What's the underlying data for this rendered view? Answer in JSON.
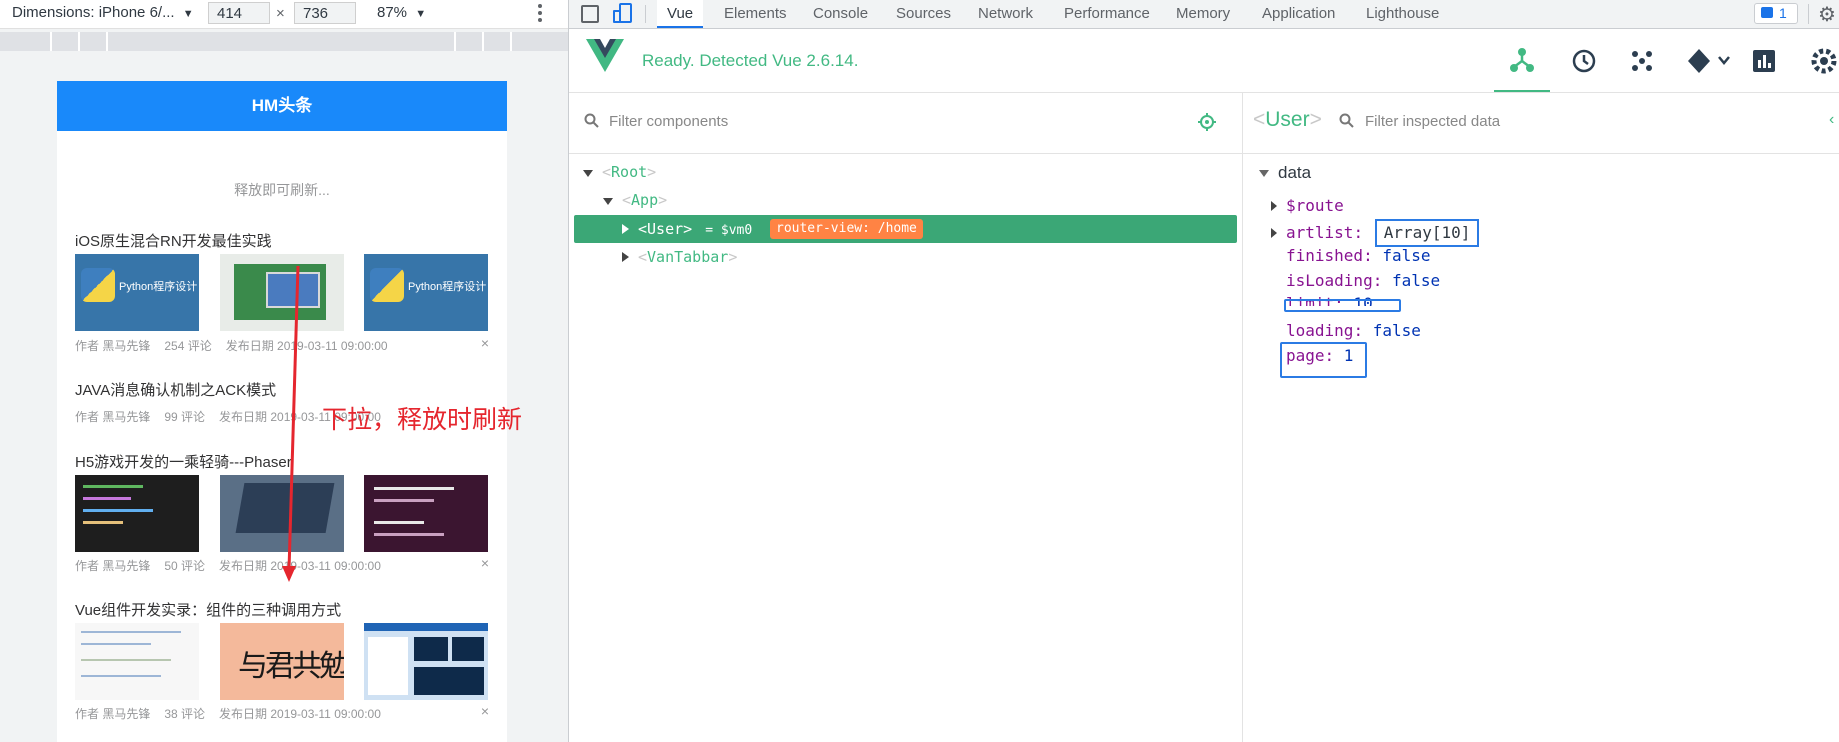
{
  "device_toolbar": {
    "dimensions_label": "Dimensions: iPhone 6/...",
    "width": "414",
    "times": "×",
    "height": "736",
    "zoom": "87%",
    "more_icon": "kebab-menu-icon"
  },
  "phone": {
    "nav_title": "HM头条",
    "pull_text": "释放即可刷新...",
    "articles": [
      {
        "title": "iOS原生混合RN开发最佳实践",
        "author": "作者 黑马先锋",
        "comments": "254 评论",
        "date": "发布日期 2019-03-11 09:00:00",
        "thumbs": [
          "python",
          "circuit",
          "python"
        ],
        "thumb_text": "Python程序设计"
      },
      {
        "title": "JAVA消息确认机制之ACK模式",
        "author": "作者 黑马先锋",
        "comments": "99 评论",
        "date": "发布日期 2019-03-11 09:00:00"
      },
      {
        "title": "H5游戏开发的一乘轻骑---Phaser",
        "author": "作者 黑马先锋",
        "comments": "50 评论",
        "date": "发布日期 2019-03-11 09:00:00"
      },
      {
        "title": "Vue组件开发实录：组件的三种调用方式",
        "author": "作者 黑马先锋",
        "comments": "38 评论",
        "date": "发布日期 2019-03-11 09:00:00",
        "calligraphy": "与君共勉"
      }
    ],
    "close_symbol": "×",
    "annotation": "下拉，释放时刷新"
  },
  "devtools_tabs": [
    "Vue",
    "Elements",
    "Console",
    "Sources",
    "Network",
    "Performance",
    "Memory",
    "Application",
    "Lighthouse"
  ],
  "active_tab": "Vue",
  "message_count": "1",
  "vue": {
    "status": "Ready. Detected Vue 2.6.14.",
    "accent_color": "#42b983",
    "filter_components_placeholder": "Filter components",
    "tree": {
      "root": "Root",
      "app": "App",
      "user": "User",
      "user_suffix": "= $vm0",
      "router_badge": "router-view: /home",
      "tabbar": "VanTabbar"
    },
    "inspector": {
      "component": "User",
      "filter_placeholder": "Filter inspected data",
      "section": "data",
      "props": [
        {
          "key": "$route",
          "value": "",
          "expandable": true
        },
        {
          "key": "artlist",
          "value": "Array[10]",
          "expandable": true
        },
        {
          "key": "finished",
          "value": "false",
          "expandable": false
        },
        {
          "key": "isLoading",
          "value": "false",
          "expandable": false
        },
        {
          "key": "limit",
          "value": "10",
          "expandable": false
        },
        {
          "key": "loading",
          "value": "false",
          "expandable": false
        },
        {
          "key": "page",
          "value": "1",
          "expandable": false
        }
      ]
    }
  }
}
